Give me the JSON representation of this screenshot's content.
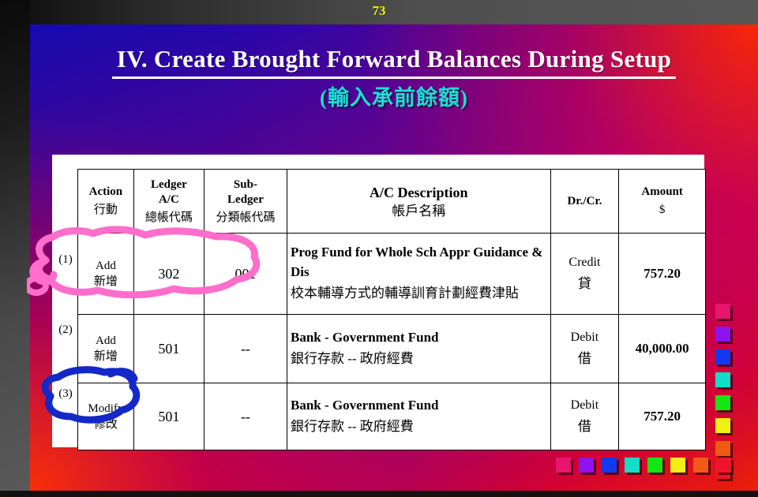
{
  "slide": {
    "page_number": "73",
    "title_en": "IV.  Create Brought Forward Balances During Setup",
    "title_zh": "(輸入承前餘額)"
  },
  "table": {
    "headers": {
      "index": "",
      "action_en": "Action",
      "action_zh": "行動",
      "ledger_en_1": "Ledger",
      "ledger_en_2": "A/C",
      "ledger_zh": "總帳代碼",
      "subledger_en_1": "Sub-",
      "subledger_en_2": "Ledger",
      "subledger_zh": "分類帳代碼",
      "description_en": "A/C Description",
      "description_zh": "帳戶名稱",
      "drcr_en": "Dr./Cr.",
      "drcr_zh": "",
      "amount_en": "Amount",
      "amount_zh": "$"
    },
    "rows": [
      {
        "index": "(1)",
        "action_en": "Add",
        "action_zh": "新增",
        "ledger_ac": "302",
        "sub_ledger": "001",
        "description_en": "Prog Fund for Whole Sch Appr Guidance & Dis",
        "description_zh": "校本輔導方式的輔導訓育計劃經費津貼",
        "drcr_en": "Credit",
        "drcr_zh": "貸",
        "amount": "757.20"
      },
      {
        "index": "(2)",
        "action_en": "Add",
        "action_zh": "新增",
        "ledger_ac": "501",
        "sub_ledger": "--",
        "description_en": "Bank - Government Fund",
        "description_zh": "銀行存款 -- 政府經費",
        "drcr_en": "Debit",
        "drcr_zh": "借",
        "amount": "40,000.00"
      },
      {
        "index": "(3)",
        "action_en": "Modify",
        "action_zh": "修改",
        "ledger_ac": "501",
        "sub_ledger": "--",
        "description_en": "Bank - Government Fund",
        "description_zh": "銀行存款 -- 政府經費",
        "drcr_en": "Debit",
        "drcr_zh": "借",
        "amount": "757.20"
      }
    ]
  },
  "annotations": [
    {
      "name": "pink-circle-row-1",
      "color": "#ff6ecb"
    },
    {
      "name": "blue-circle-row-3",
      "color": "#1428c8"
    }
  ],
  "decorations": {
    "square_colors": [
      "#e8146e",
      "#8c14f0",
      "#1438f0",
      "#14dcc8",
      "#14e614",
      "#f0f014",
      "#f05a14",
      "#f01428"
    ]
  },
  "colors": {
    "page_number": "#f2f224",
    "title_en": "#ffffff",
    "title_zh": "#19e0d2",
    "panel_background": "#ffffff",
    "table_border": "#000000"
  }
}
